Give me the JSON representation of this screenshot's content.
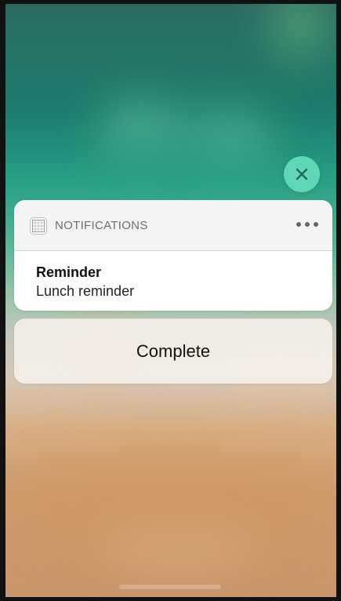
{
  "notification": {
    "app_name": "NOTIFICATIONS",
    "app_icon": "calendar-grid-icon",
    "more_icon": "more-horizontal-icon",
    "title": "Reminder",
    "body": "Lunch reminder"
  },
  "actions": {
    "complete_label": "Complete",
    "dismiss_icon": "close-icon"
  },
  "colors": {
    "dismiss_button": "#5fd6b5",
    "card_background": "#ffffff",
    "header_background": "#f4f4f4",
    "action_background": "#f5f0ea"
  }
}
